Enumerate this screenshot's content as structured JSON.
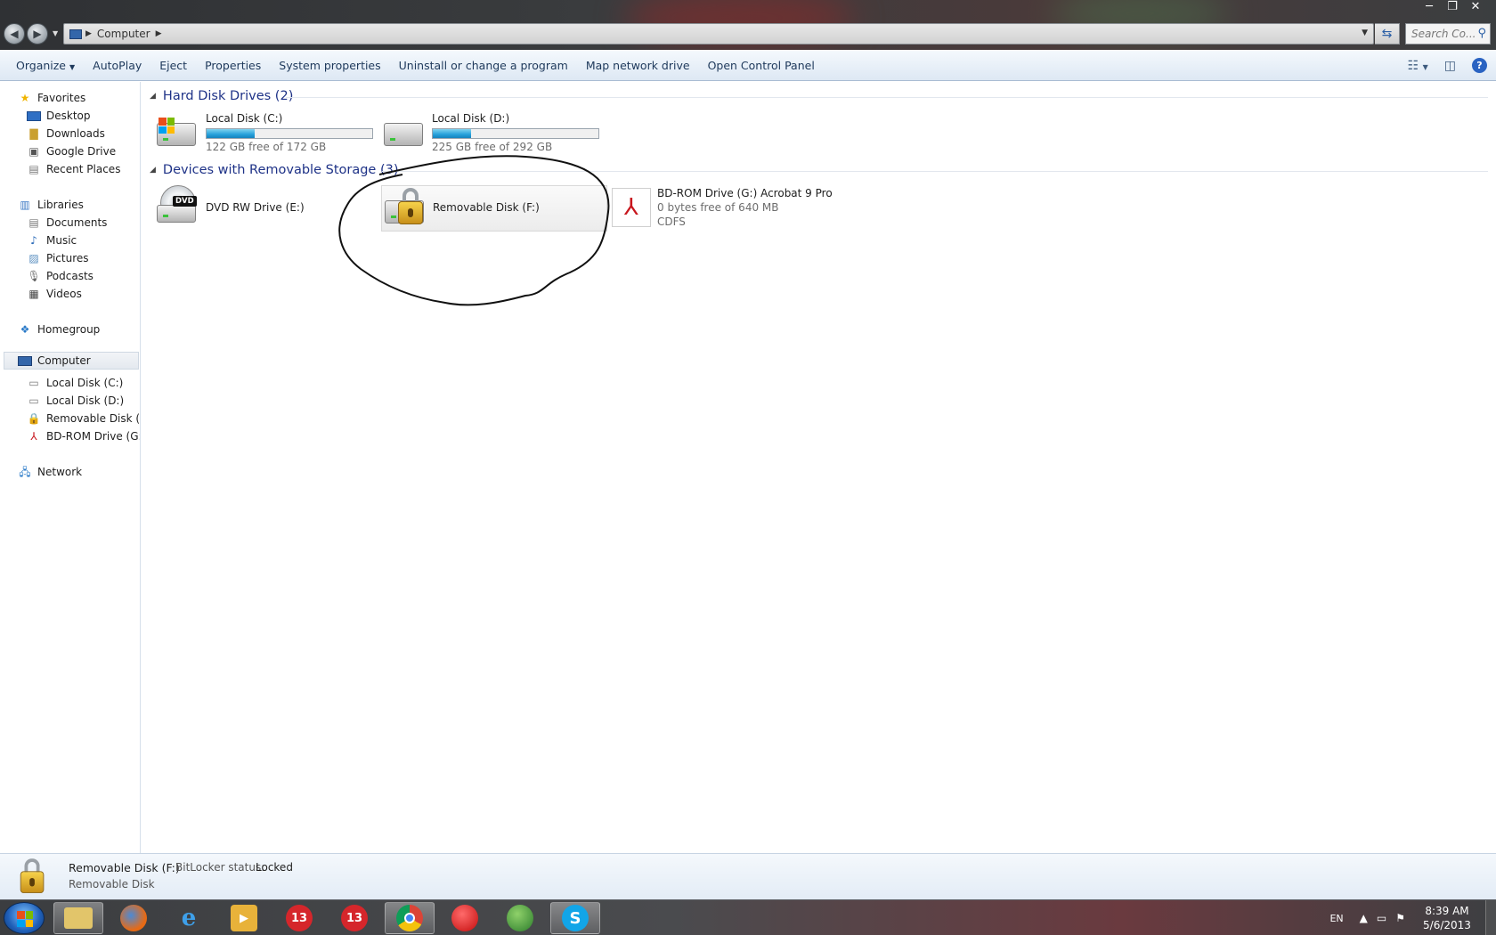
{
  "window": {
    "minimize": "─",
    "maximize": "❐",
    "close": "✕"
  },
  "address": {
    "crumbs": [
      "Computer"
    ],
    "search_placeholder": "Search Co..."
  },
  "toolbar": {
    "organize": "Organize",
    "autoplay": "AutoPlay",
    "eject": "Eject",
    "properties": "Properties",
    "system_properties": "System properties",
    "uninstall": "Uninstall or change a program",
    "map_drive": "Map network drive",
    "control_panel": "Open Control Panel",
    "help": "?"
  },
  "nav": {
    "favorites": "Favorites",
    "desktop": "Desktop",
    "downloads": "Downloads",
    "google_drive": "Google Drive",
    "recent_places": "Recent Places",
    "libraries": "Libraries",
    "documents": "Documents",
    "music": "Music",
    "pictures": "Pictures",
    "podcasts": "Podcasts",
    "videos": "Videos",
    "homegroup": "Homegroup",
    "computer": "Computer",
    "local_c": "Local Disk (C:)",
    "local_d": "Local Disk (D:)",
    "removable_f": "Removable Disk (F:)",
    "bdrom_g": "BD-ROM Drive (G:) A",
    "network": "Network"
  },
  "groups": {
    "hdd_title": "Hard Disk Drives (2)",
    "removable_title": "Devices with Removable Storage (3)"
  },
  "drives": {
    "c": {
      "name": "Local Disk (C:)",
      "space": "122 GB free of 172 GB",
      "used_fraction": 0.29
    },
    "d": {
      "name": "Local Disk (D:)",
      "space": "225 GB free of 292 GB",
      "used_fraction": 0.23
    },
    "e": {
      "name": "DVD RW Drive (E:)",
      "label": "DVD"
    },
    "f": {
      "name": "Removable Disk (F:)"
    },
    "g": {
      "name": "BD-ROM Drive (G:) Acrobat 9 Pro",
      "space": "0 bytes free of 640 MB",
      "fs": "CDFS"
    }
  },
  "details": {
    "name": "Removable Disk (F:)",
    "bitlocker_label": "BitLocker status:",
    "bitlocker_value": "Locked",
    "type": "Removable Disk"
  },
  "taskbar": {
    "apps": [
      "explorer",
      "firefox",
      "internet-explorer",
      "media-player",
      "badge-13",
      "badge-13",
      "chrome",
      "record",
      "network-globe",
      "skype"
    ],
    "badge_13": "13",
    "skype_letter": "S",
    "lang": "EN",
    "time": "8:39 AM",
    "date": "5/6/2013"
  }
}
